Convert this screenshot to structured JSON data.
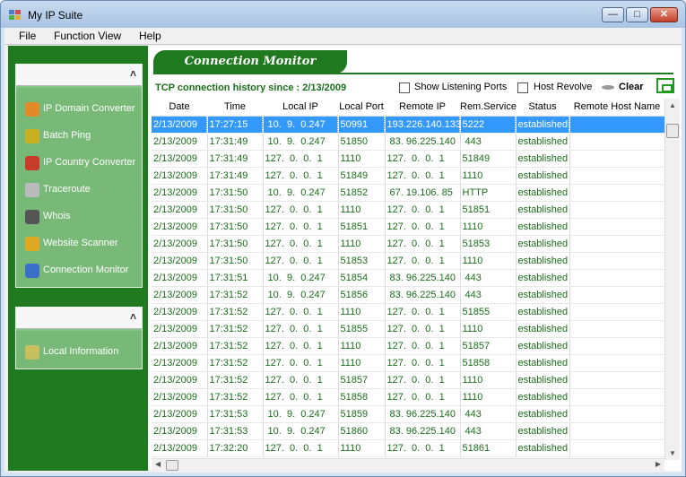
{
  "window": {
    "title": "My IP Suite",
    "minimize_glyph": "—",
    "maximize_glyph": "□",
    "close_glyph": "✕"
  },
  "menu": [
    "File",
    "Function View",
    "Help"
  ],
  "sidebar": {
    "collapse_glyph": "˄",
    "tools": [
      {
        "label": "IP Domain Converter",
        "icon": "domain-converter-icon",
        "color": "#e08a2a"
      },
      {
        "label": "Batch Ping",
        "icon": "batch-ping-icon",
        "color": "#c8b020"
      },
      {
        "label": "IP Country Converter",
        "icon": "country-converter-icon",
        "color": "#c83a2a"
      },
      {
        "label": "Traceroute",
        "icon": "traceroute-icon",
        "color": "#bbbbbb"
      },
      {
        "label": "Whois",
        "icon": "whois-icon",
        "color": "#555555"
      },
      {
        "label": "Website Scanner",
        "icon": "website-scanner-icon",
        "color": "#e0a820"
      },
      {
        "label": "Connection Monitor",
        "icon": "connection-monitor-icon",
        "color": "#3a70c8"
      }
    ],
    "info": [
      {
        "label": "Local Information",
        "icon": "local-info-icon",
        "color": "#c8c060"
      }
    ]
  },
  "main": {
    "banner": "Connection Monitor",
    "history_label": "TCP connection history since : 2/13/2009",
    "show_listening_label": "Show Listening Ports",
    "show_listening_checked": false,
    "host_revolve_label": "Host Revolve",
    "host_revolve_checked": false,
    "clear_label": "Clear"
  },
  "table": {
    "columns": [
      "Date",
      "Time",
      "Local IP",
      "Local Port",
      "Remote IP",
      "Rem.Service",
      "Status",
      "Remote Host Name"
    ],
    "selected_row": 0,
    "rows": [
      [
        "2/13/2009",
        "17:27:15",
        " 10.  9.  0.247",
        "50991",
        "193.226.140.133",
        "5222",
        "established",
        ""
      ],
      [
        "2/13/2009",
        "17:31:49",
        " 10.  9.  0.247",
        "51850",
        " 83. 96.225.140",
        " 443",
        "established",
        ""
      ],
      [
        "2/13/2009",
        "17:31:49",
        "127.  0.  0.  1",
        "1110",
        "127.  0.  0.  1",
        "51849",
        "established",
        ""
      ],
      [
        "2/13/2009",
        "17:31:49",
        "127.  0.  0.  1",
        "51849",
        "127.  0.  0.  1",
        "1110",
        "established",
        ""
      ],
      [
        "2/13/2009",
        "17:31:50",
        " 10.  9.  0.247",
        "51852",
        " 67. 19.106. 85",
        "HTTP",
        "established",
        ""
      ],
      [
        "2/13/2009",
        "17:31:50",
        "127.  0.  0.  1",
        "1110",
        "127.  0.  0.  1",
        "51851",
        "established",
        ""
      ],
      [
        "2/13/2009",
        "17:31:50",
        "127.  0.  0.  1",
        "51851",
        "127.  0.  0.  1",
        "1110",
        "established",
        ""
      ],
      [
        "2/13/2009",
        "17:31:50",
        "127.  0.  0.  1",
        "1110",
        "127.  0.  0.  1",
        "51853",
        "established",
        ""
      ],
      [
        "2/13/2009",
        "17:31:50",
        "127.  0.  0.  1",
        "51853",
        "127.  0.  0.  1",
        "1110",
        "established",
        ""
      ],
      [
        "2/13/2009",
        "17:31:51",
        " 10.  9.  0.247",
        "51854",
        " 83. 96.225.140",
        " 443",
        "established",
        ""
      ],
      [
        "2/13/2009",
        "17:31:52",
        " 10.  9.  0.247",
        "51856",
        " 83. 96.225.140",
        " 443",
        "established",
        ""
      ],
      [
        "2/13/2009",
        "17:31:52",
        "127.  0.  0.  1",
        "1110",
        "127.  0.  0.  1",
        "51855",
        "established",
        ""
      ],
      [
        "2/13/2009",
        "17:31:52",
        "127.  0.  0.  1",
        "51855",
        "127.  0.  0.  1",
        "1110",
        "established",
        ""
      ],
      [
        "2/13/2009",
        "17:31:52",
        "127.  0.  0.  1",
        "1110",
        "127.  0.  0.  1",
        "51857",
        "established",
        ""
      ],
      [
        "2/13/2009",
        "17:31:52",
        "127.  0.  0.  1",
        "1110",
        "127.  0.  0.  1",
        "51858",
        "established",
        ""
      ],
      [
        "2/13/2009",
        "17:31:52",
        "127.  0.  0.  1",
        "51857",
        "127.  0.  0.  1",
        "1110",
        "established",
        ""
      ],
      [
        "2/13/2009",
        "17:31:52",
        "127.  0.  0.  1",
        "51858",
        "127.  0.  0.  1",
        "1110",
        "established",
        ""
      ],
      [
        "2/13/2009",
        "17:31:53",
        " 10.  9.  0.247",
        "51859",
        " 83. 96.225.140",
        " 443",
        "established",
        ""
      ],
      [
        "2/13/2009",
        "17:31:53",
        " 10.  9.  0.247",
        "51860",
        " 83. 96.225.140",
        " 443",
        "established",
        ""
      ],
      [
        "2/13/2009",
        "17:32:20",
        "127.  0.  0.  1",
        "1110",
        "127.  0.  0.  1",
        "51861",
        "established",
        ""
      ]
    ]
  },
  "colors": {
    "accent_green": "#1f7a1f",
    "row_text": "#1a6e1a",
    "selection": "#3399ff"
  }
}
